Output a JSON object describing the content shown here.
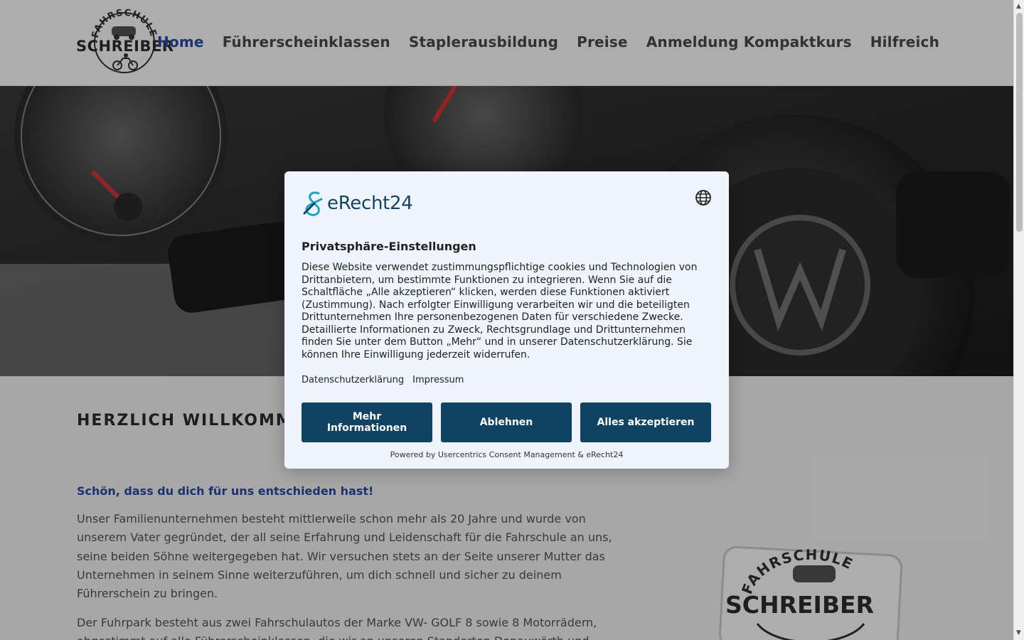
{
  "header": {
    "logo_text": "FAHRSCHULE SCHREIBER",
    "nav": [
      {
        "label": "Home"
      },
      {
        "label": "Führerscheinklassen"
      },
      {
        "label": "Staplerausbildung"
      },
      {
        "label": "Preise"
      },
      {
        "label": "Anmeldung Kompaktkurs"
      },
      {
        "label": "Hilfreich"
      }
    ],
    "active_index": 0
  },
  "content": {
    "welcome": "HERZLICH WILLKOMMEN",
    "tagline": "Schön, dass du dich für uns entschieden hast!",
    "paragraph1": "Unser Familienunternehmen besteht mittlerweile schon mehr als 20 Jahre und wurde von unserem Vater gegründet, der all seine Erfahrung und Leidenschaft für die Fahrschule an uns, seine beiden Söhne weitergegeben hat. Wir versuchen stets an der Seite unserer Mutter das Unternehmen in seinem Sinne weiterzuführen, um dich schnell und sicher zu deinem Führerschein zu bringen.",
    "paragraph2": "Der Fuhrpark besteht aus zwei Fahrschulautos der Marke VW- GOLF 8 sowie 8 Motorrädern, abgestimmt auf alle Führerscheinklassen, die wir an unseren Standorten Donauwörth und",
    "badge_text": "FAHRSCHULE SCHREIBER"
  },
  "consent": {
    "brand": "eRecht24",
    "globe_icon": "globe-icon",
    "title": "Privatsphäre-Einstellungen",
    "body": "Diese Website verwendet zustimmungspflichtige cookies und Technologien von Drittanbietern, um bestimmte Funktionen zu integrieren. Wenn Sie auf die Schaltfläche „Alle akzeptieren“ klicken, werden diese Funktionen aktiviert (Zustimmung). Nach erfolgter Einwilligung verarbeiten wir und die beteiligten Drittunternehmen Ihre personenbezogenen Daten für verschiedene Zwecke. Detaillierte Informationen zu Zweck, Rechtsgrundlage und Drittunternehmen finden Sie unter dem Button „Mehr“ und in unserer Datenschutzerklärung. Sie können Ihre Einwilligung jederzeit widerrufen.",
    "link_privacy": "Datenschutzerklärung",
    "link_imprint": "Impressum",
    "btn_more": "Mehr Informationen",
    "btn_decline": "Ablehnen",
    "btn_accept": "Alles akzeptieren",
    "powered": "Powered by Usercentrics Consent Management & eRecht24"
  },
  "colors": {
    "nav_active": "#2c4aa3",
    "button_bg": "#0f4361",
    "dialog_bg": "#eef5fc"
  }
}
